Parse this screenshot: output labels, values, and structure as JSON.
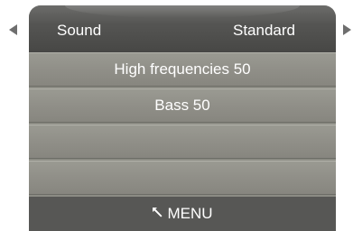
{
  "navigation": {
    "left_arrow_icon": "left-arrow-icon",
    "right_arrow_icon": "right-arrow-icon"
  },
  "header": {
    "title": "Sound",
    "value": "Standard"
  },
  "menu_items": [
    {
      "label": "High frequencies  50"
    },
    {
      "label": "Bass 50"
    },
    {
      "label": ""
    },
    {
      "label": ""
    }
  ],
  "footer": {
    "return_icon": "return-arrow-icon",
    "label": "MENU"
  },
  "colors": {
    "header_bg": "#555553",
    "row_bg": "#908f88",
    "footer_bg": "#575755",
    "text": "#ffffff",
    "arrow": "#6e6e6e"
  }
}
